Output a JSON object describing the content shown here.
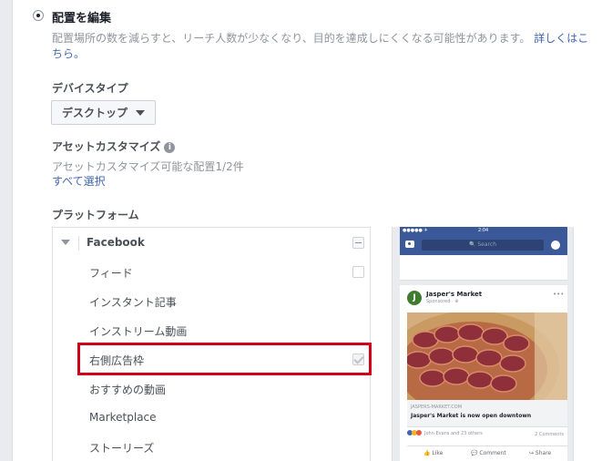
{
  "placement": {
    "title": "配置を編集",
    "description": "配置場所の数を減らすと、リーチ人数が少なくなり、目的を達成しにくくなる可能性があります。 ",
    "learn_more_line1": "詳しくはこ",
    "learn_more_line2": "ちら。"
  },
  "device": {
    "label": "デバイスタイプ",
    "selected": "デスクトップ"
  },
  "asset": {
    "label": "アセットカスタマイズ",
    "info_icon": "i",
    "subtext": "アセットカスタマイズ可能な配置1/2件",
    "select_all": "すべて選択"
  },
  "platform": {
    "label": "プラットフォーム",
    "group": "Facebook",
    "items": [
      {
        "label": "フィード",
        "checked": false
      },
      {
        "label": "インスタント記事",
        "checked": null
      },
      {
        "label": "インストリーム動画",
        "checked": null
      },
      {
        "label": "右側広告枠",
        "checked": true,
        "highlighted": true
      },
      {
        "label": "おすすめの動画",
        "checked": null
      },
      {
        "label": "Marketplace",
        "checked": null
      },
      {
        "label": "ストーリーズ",
        "checked": null
      }
    ]
  },
  "preview": {
    "status_left": "●●●●● ✈",
    "status_time": "2:04",
    "search_placeholder": "🔍 Search",
    "advertiser": "Jasper's Market",
    "logo_letter": "J",
    "sponsored": "Sponsored · ⊕",
    "more": "•••",
    "domain": "JASPERS-MARKET.COM",
    "headline": "Jasper's Market is now open downtown",
    "reactions": "John Evans and 23 others",
    "comments": "2 Comments",
    "like": "👍 Like",
    "comment": "💬 Comment",
    "share": "↪ Share"
  },
  "colors": {
    "link": "#4267b2",
    "highlight_border": "#d0021b",
    "fb_blue": "#3b5998"
  }
}
